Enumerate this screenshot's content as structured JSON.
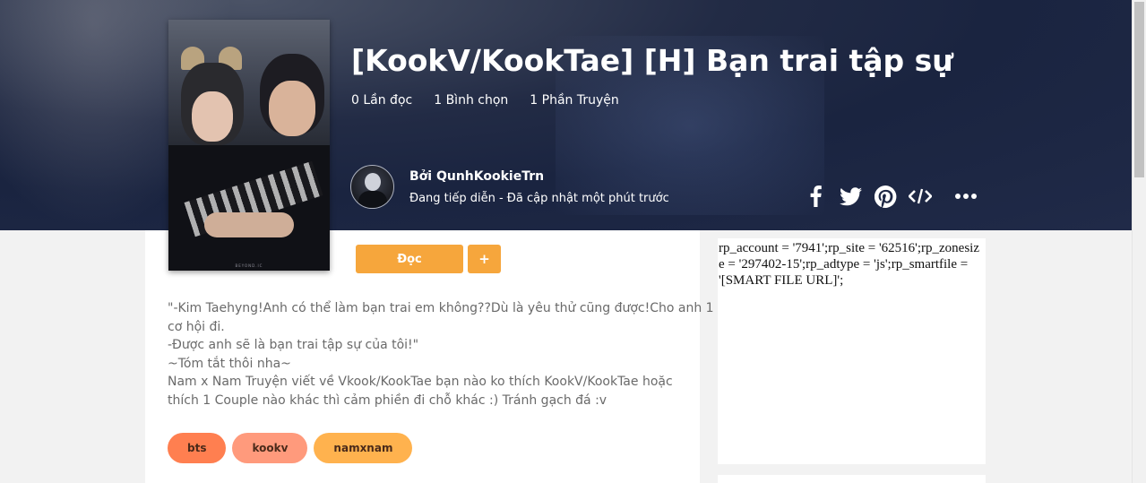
{
  "story": {
    "title": "[KookV/KookTae] [H] Bạn trai tập sự",
    "stats": {
      "reads": "0 Lần đọc",
      "votes": "1 Bình chọn",
      "parts": "1 Phần Truyện"
    },
    "cover_brand": "BEYOND.IC"
  },
  "author": {
    "by_line": "Bởi QunhKookieTrn",
    "status": "Đang tiếp diễn - Đã cập nhật một phút trước"
  },
  "share": {
    "icons": [
      "facebook-icon",
      "twitter-icon",
      "pinterest-icon",
      "embed-code-icon",
      "more-options-icon"
    ]
  },
  "actions": {
    "read_label": "Đọc",
    "add_label": "+"
  },
  "description": {
    "lines": [
      "\"-Kim Taehyng!Anh có thể làm bạn trai em không??Dù là yêu thử cũng được!Cho anh 1",
      "cơ hội đi.",
      "-Được anh sẽ là bạn trai tập sự của tôi!\"",
      "~Tóm tắt thôi nha~",
      "Nam x Nam Truyện viết về Vkook/KookTae bạn nào ko thích KookV/KookTae hoặc",
      "thích 1 Couple nào khác thì cảm phiền đi chỗ khác :) Tránh gạch đá :v"
    ]
  },
  "tags": [
    {
      "label": "bts",
      "color": "#ff7f50"
    },
    {
      "label": "kookv",
      "color": "#ff9a7c"
    },
    {
      "label": "namxnam",
      "color": "#ffb24e"
    }
  ],
  "ad": {
    "text": "rp_account = '7941';rp_site = '62516';rp_zonesize = '297402-15';rp_adtype = 'js';rp_smartfile = '[SMART FILE URL]';"
  },
  "colors": {
    "hero_bg": "#1f2842",
    "accent_orange": "#f6a63c"
  }
}
